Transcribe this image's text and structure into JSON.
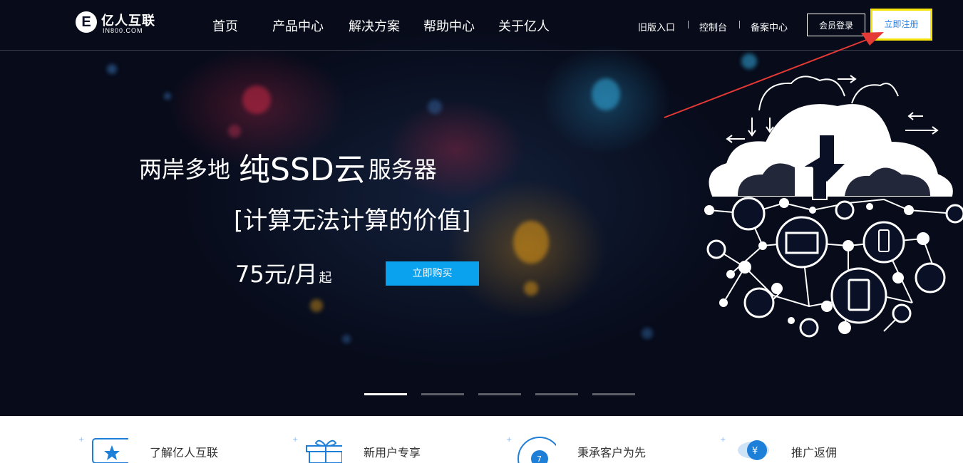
{
  "brand": {
    "name": "亿人互联",
    "domain_text": "IN800.COM",
    "logo_letter": "E"
  },
  "nav": {
    "items": [
      {
        "label": "首页"
      },
      {
        "label": "产品中心"
      },
      {
        "label": "解决方案"
      },
      {
        "label": "帮助中心"
      },
      {
        "label": "关于亿人"
      }
    ]
  },
  "utility_links": [
    {
      "label": "旧版入口"
    },
    {
      "label": "控制台"
    },
    {
      "label": "备案中心"
    }
  ],
  "auth": {
    "login_label": "会员登录",
    "register_label": "立即注册"
  },
  "hero": {
    "line1_prefix": "两岸多地",
    "line1_big": "纯SSD云",
    "line1_suffix": "服务器",
    "line2": "[计算无法计算的价值]",
    "price": "75元/月",
    "price_suffix": "起",
    "buy_label": "立即购买"
  },
  "slider": {
    "count": 5,
    "active_index": 0
  },
  "features": [
    {
      "label": "了解亿人互联",
      "icon": "star-card-icon"
    },
    {
      "label": "新用户专享",
      "icon": "gift-box-icon"
    },
    {
      "label": "秉承客户为先",
      "icon": "clock-badge-icon"
    },
    {
      "label": "推广返佣",
      "icon": "yen-coin-icon"
    }
  ],
  "colors": {
    "accent_blue": "#0aa1ee",
    "register_text": "#2a7fe3",
    "highlight_yellow": "#f7e40a",
    "annotation_red": "#e53935",
    "hero_dark": "#070b1a"
  }
}
